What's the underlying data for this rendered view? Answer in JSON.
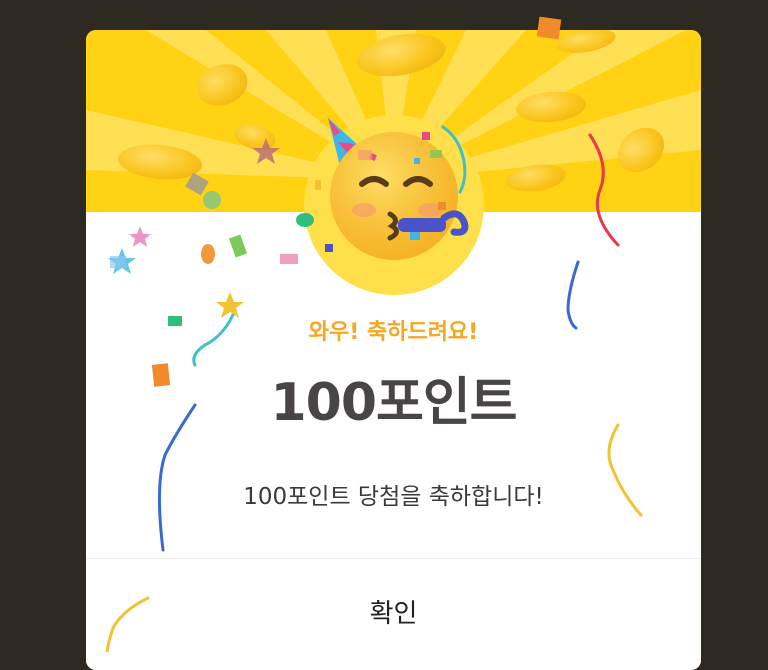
{
  "dialog": {
    "headline": "와우! 축하드려요!",
    "points_title": "100포인트",
    "description": "100포인트 당첨을 축하합니다!",
    "confirm_label": "확인"
  },
  "illustration": {
    "emoji": "party-face-icon"
  },
  "colors": {
    "banner": "#ffd313",
    "headline": "#f5a623",
    "title": "#4a4545",
    "backdrop": "#2e2a22"
  }
}
